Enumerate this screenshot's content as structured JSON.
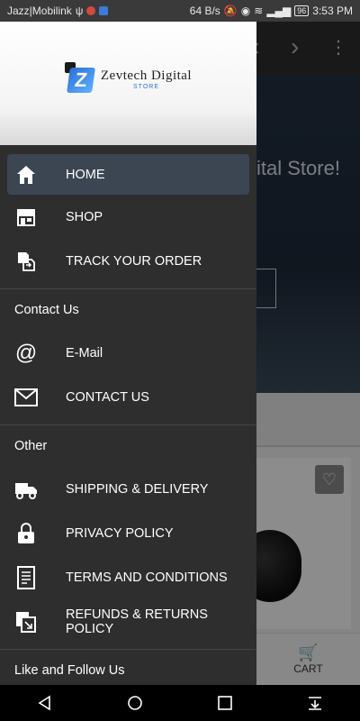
{
  "status_bar": {
    "carrier": "Jazz|Mobilink",
    "speed": "64 B/s",
    "battery": "96",
    "time": "3:53 PM"
  },
  "drawer": {
    "logo": {
      "name": "Zevtech Digital",
      "tag": "STORE"
    },
    "main_items": [
      {
        "label": "HOME",
        "icon": "home-icon",
        "active": true
      },
      {
        "label": "SHOP",
        "icon": "shop-icon"
      },
      {
        "label": "TRACK YOUR ORDER",
        "icon": "track-order-icon"
      }
    ],
    "contact_section": {
      "title": "Contact Us",
      "items": [
        {
          "label": "E-Mail",
          "icon": "at-icon"
        },
        {
          "label": "CONTACT US",
          "icon": "envelope-icon"
        }
      ]
    },
    "other_section": {
      "title": "Other",
      "items": [
        {
          "label": "SHIPPING & DELIVERY",
          "icon": "truck-icon"
        },
        {
          "label": "PRIVACY POLICY",
          "icon": "lock-icon"
        },
        {
          "label": "TERMS AND CONDITIONS",
          "icon": "document-icon"
        },
        {
          "label": "REFUNDS & RETURNS POLICY",
          "icon": "returns-icon"
        }
      ]
    },
    "follow_title": "Like and Follow Us"
  },
  "background_app": {
    "hero_text": "ital Store!",
    "cart_label": "CART"
  },
  "colors": {
    "drawer_bg": "#2e2e2e",
    "active_bg": "#3b4652",
    "logo_blue": "#2a6fd6"
  }
}
